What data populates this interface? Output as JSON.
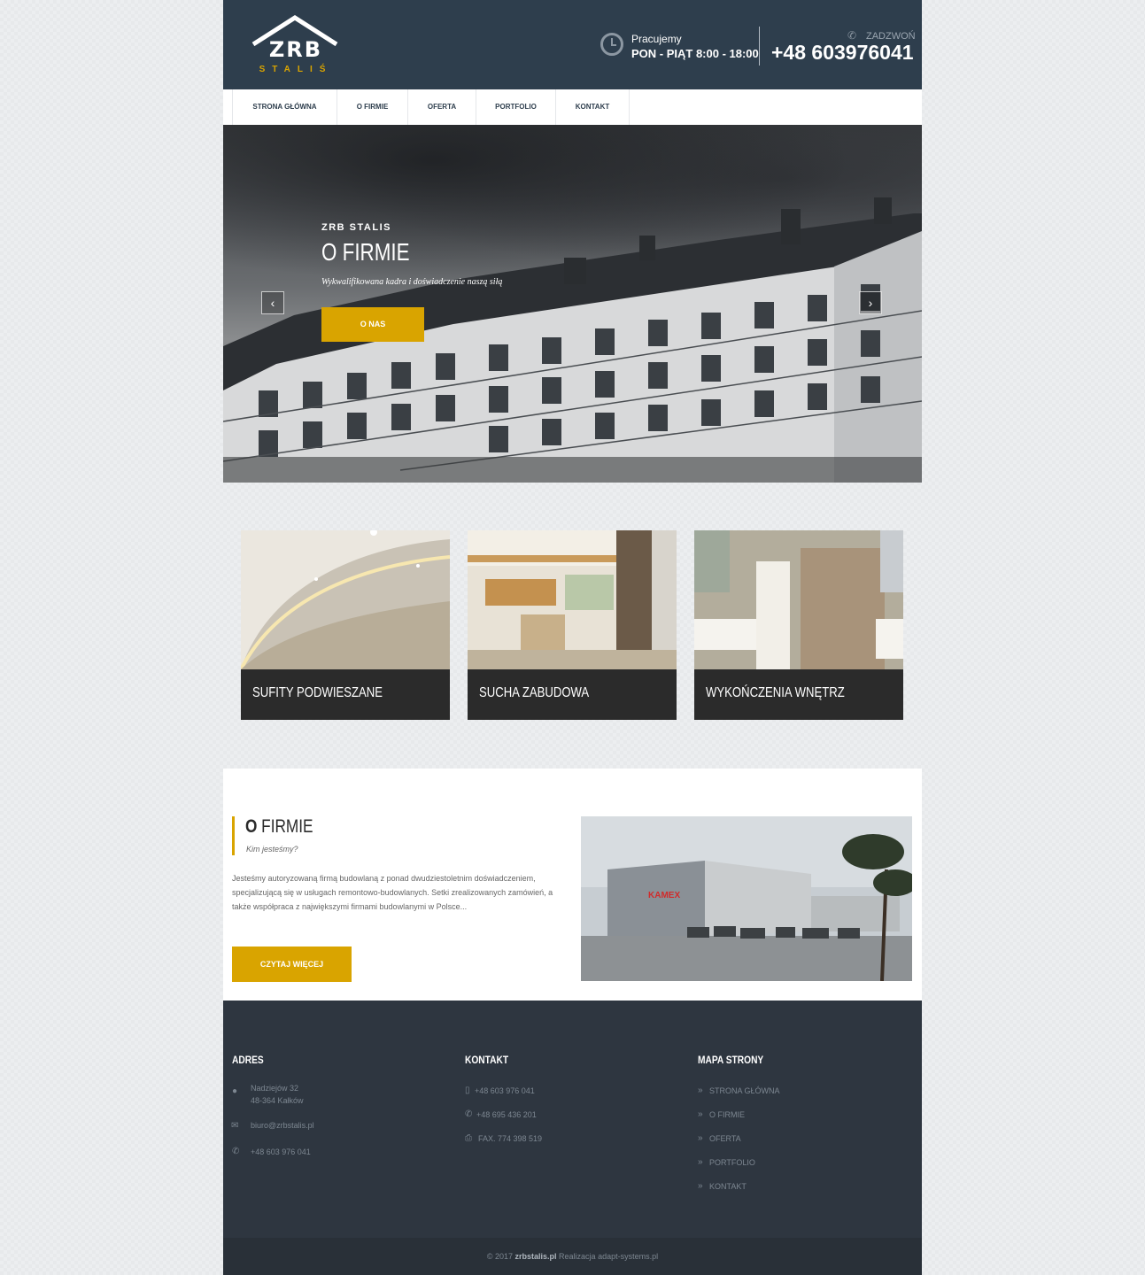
{
  "header": {
    "logo_text": "ZRB",
    "logo_subtext": "STALIŚ",
    "hours_label": "Pracujemy",
    "hours_value": "PON - PIĄT 8:00 - 18:00",
    "call_label": "ZADZWOŃ",
    "call_number": "+48 603976041"
  },
  "nav": {
    "items": [
      {
        "label": "STRONA GŁÓWNA"
      },
      {
        "label": "O FIRMIE"
      },
      {
        "label": "OFERTA"
      },
      {
        "label": "PORTFOLIO"
      },
      {
        "label": "KONTAKT"
      }
    ]
  },
  "hero": {
    "kicker": "ZRB STALIS",
    "title": "O FIRMIE",
    "tagline": "Wykwalifikowana kadra i doświadczenie naszą siłą",
    "button": "O NAS",
    "prev": "‹",
    "next": "›"
  },
  "services": [
    {
      "label": "SUFITY PODWIESZANE"
    },
    {
      "label": "SUCHA ZABUDOWA"
    },
    {
      "label": "WYKOŃCZENIA WNĘTRZ"
    }
  ],
  "about": {
    "title_bold": "O",
    "title_rest": " FIRMIE",
    "subtitle": "Kim jesteśmy?",
    "text": "Jesteśmy autoryzowaną firmą budowlaną z ponad dwudziestoletnim doświadczeniem, specjalizującą się w usługach remontowo-budowlanych. Setki zrealizowanych zamówień, a także współpraca z największymi firmami budowlanymi w Polsce...",
    "button": "CZYTAJ WIĘCEJ",
    "sign": "KAMEX"
  },
  "footer": {
    "address": {
      "heading": "ADRES",
      "street": "Nadziejów 32",
      "city": "48-364 Kałków",
      "email": "biuro@zrbstalis.pl",
      "phone": "+48 603 976 041"
    },
    "contact": {
      "heading": "KONTAKT",
      "mobile": "+48 603 976 041",
      "phone": "+48 695 436 201",
      "fax": "FAX. 774 398 519"
    },
    "sitemap": {
      "heading": "MAPA STRONY",
      "links": [
        "STRONA GŁÓWNA",
        "O FIRMIE",
        "OFERTA",
        "PORTFOLIO",
        "KONTAKT"
      ]
    },
    "copyright_prefix": "© 2017 ",
    "copyright_site": "zrbstalis.pl",
    "copyright_suffix": " Realizacja adapt-systems.pl"
  },
  "colors": {
    "header_bg": "#2e3e4d",
    "accent": "#d9a400",
    "footer_bg": "#2e3640",
    "caption_bg": "#2b2b2b"
  }
}
